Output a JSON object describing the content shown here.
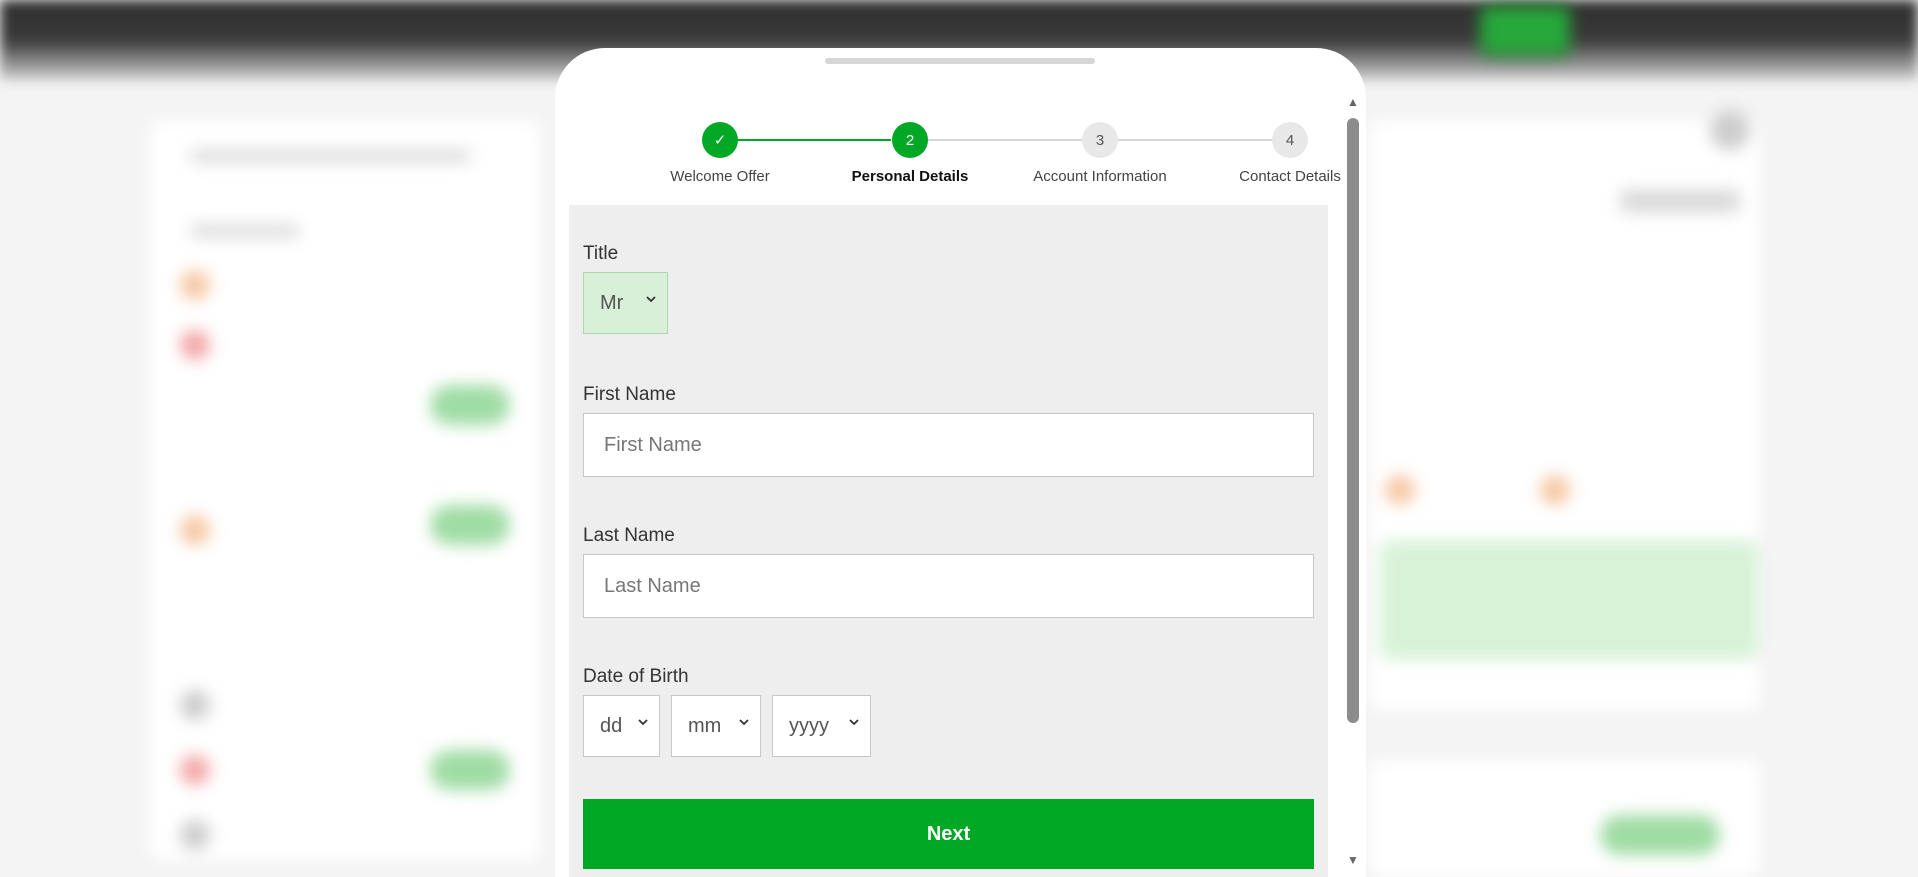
{
  "stepper": {
    "steps": [
      {
        "number": "",
        "label": "Welcome Offer",
        "state": "complete"
      },
      {
        "number": "2",
        "label": "Personal Details",
        "state": "current"
      },
      {
        "number": "3",
        "label": "Account Information",
        "state": "upcoming"
      },
      {
        "number": "4",
        "label": "Contact Details",
        "state": "upcoming"
      }
    ],
    "check_glyph": "✓"
  },
  "form": {
    "title": {
      "label": "Title",
      "value": "Mr"
    },
    "first_name": {
      "label": "First Name",
      "placeholder": "First Name"
    },
    "last_name": {
      "label": "Last Name",
      "placeholder": "Last Name"
    },
    "dob": {
      "label": "Date of Birth",
      "day": "dd",
      "month": "mm",
      "year": "yyyy"
    },
    "next_label": "Next"
  },
  "colors": {
    "accent": "#00a826",
    "selected_field_bg": "#d8efd8",
    "form_bg": "#eeeeee"
  },
  "icons": {
    "scroll_up": "scroll-up-arrow-icon",
    "scroll_down": "scroll-down-arrow-icon",
    "select": "chevron-down-icon",
    "complete": "checkmark-icon"
  }
}
